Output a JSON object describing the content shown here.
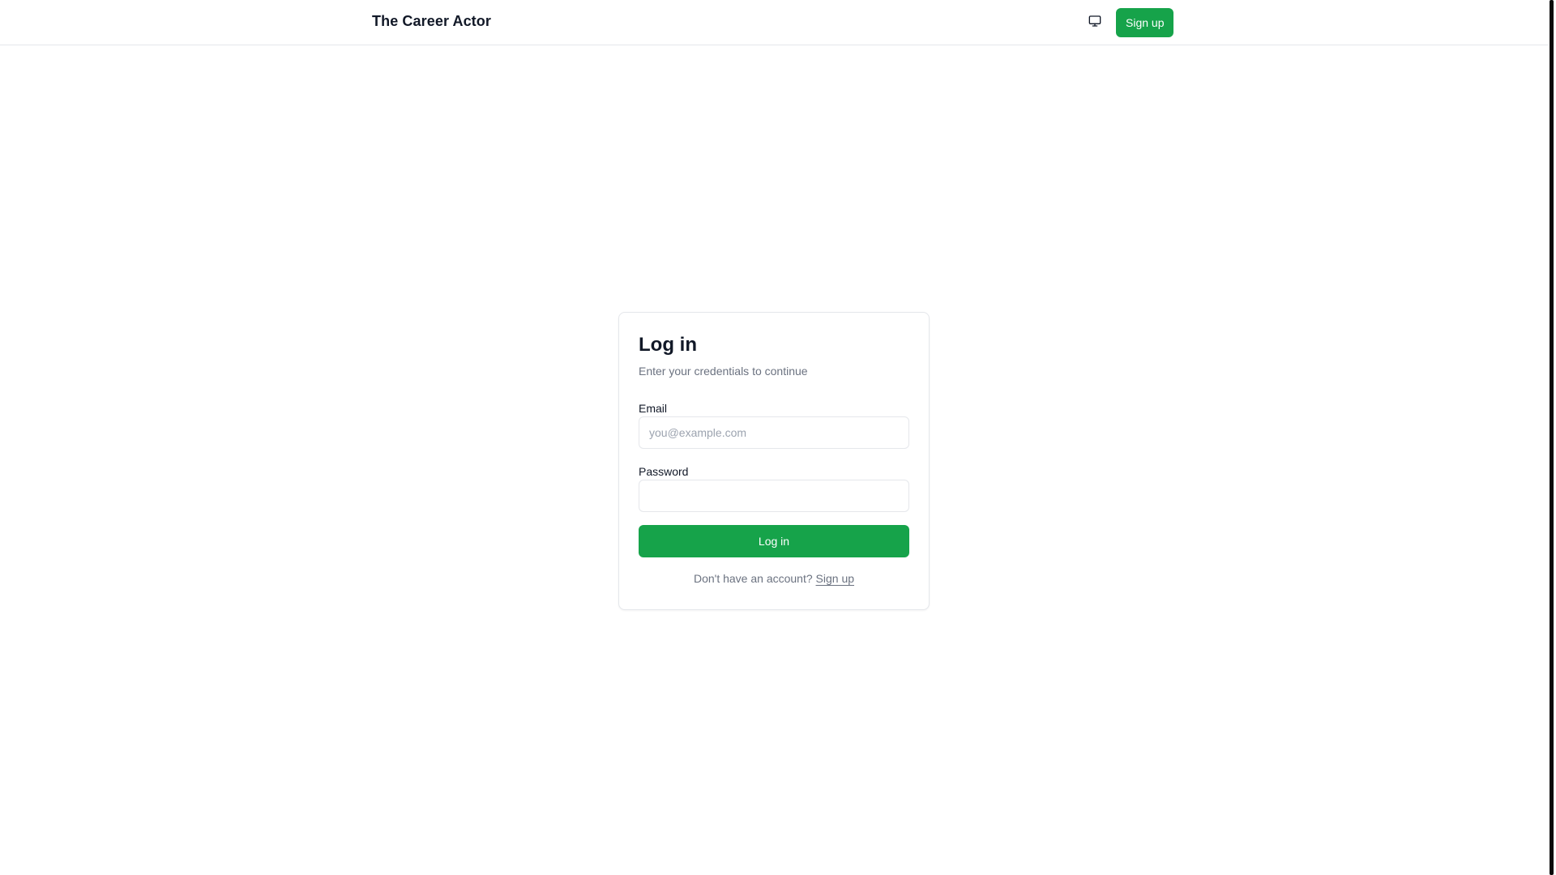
{
  "header": {
    "brand": "The Career Actor",
    "theme_toggle_icon": "monitor-icon",
    "signup_label": "Sign up"
  },
  "login_card": {
    "title": "Log in",
    "subtitle": "Enter your credentials to continue",
    "email_label": "Email",
    "email_value": "",
    "email_placeholder": "you@example.com",
    "password_label": "Password",
    "password_value": "",
    "submit_label": "Log in",
    "no_account_text": "Don't have an account?",
    "signup_link_label": "Sign up"
  },
  "colors": {
    "accent": "#16a34a",
    "border": "#e5e7eb",
    "muted_text": "#6b7280",
    "text": "#111827"
  }
}
